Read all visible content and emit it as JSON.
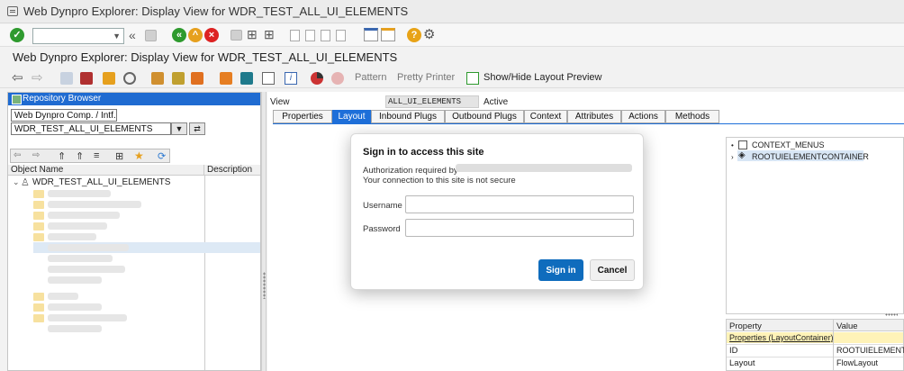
{
  "window": {
    "title": "Web Dynpro Explorer: Display View for WDR_TEST_ALL_UI_ELEMENTS"
  },
  "screen": {
    "title": "Web Dynpro Explorer: Display View for WDR_TEST_ALL_UI_ELEMENTS"
  },
  "toolbar2": {
    "pattern": "Pattern",
    "pretty_printer": "Pretty Printer",
    "layout_preview": "Show/Hide Layout Preview"
  },
  "left": {
    "header": "Repository Browser",
    "type_select": "Web Dynpro Comp. / Intf.",
    "name_select": "WDR_TEST_ALL_UI_ELEMENTS",
    "col_object": "Object Name",
    "col_desc": "Description",
    "root_item": "WDR_TEST_ALL_UI_ELEMENTS"
  },
  "view": {
    "label": "View",
    "value": "ALL_UI_ELEMENTS",
    "status": "Active"
  },
  "tabs": [
    "Properties",
    "Layout",
    "Inbound Plugs",
    "Outbound Plugs",
    "Context",
    "Attributes",
    "Actions",
    "Methods"
  ],
  "tree": {
    "item1": "CONTEXT_MENUS",
    "item2": "ROOTUIELEMENTCONTAINER"
  },
  "props": {
    "col_property": "Property",
    "col_value": "Value",
    "section": "Properties (LayoutContainer)",
    "rows": [
      {
        "name": "ID",
        "value": "ROOTUIELEMENT"
      },
      {
        "name": "Layout",
        "value": "FlowLayout"
      }
    ]
  },
  "dialog": {
    "title": "Sign in to access this site",
    "auth_text": "Authorization required by",
    "insecure_text": "Your connection to this site is not secure",
    "username_label": "Username",
    "password_label": "Password",
    "signin": "Sign in",
    "cancel": "Cancel"
  },
  "colors": {
    "sap_blue": "#1e6fd9",
    "dialog_primary": "#0f6cbd",
    "title_bar": "#ececec"
  }
}
